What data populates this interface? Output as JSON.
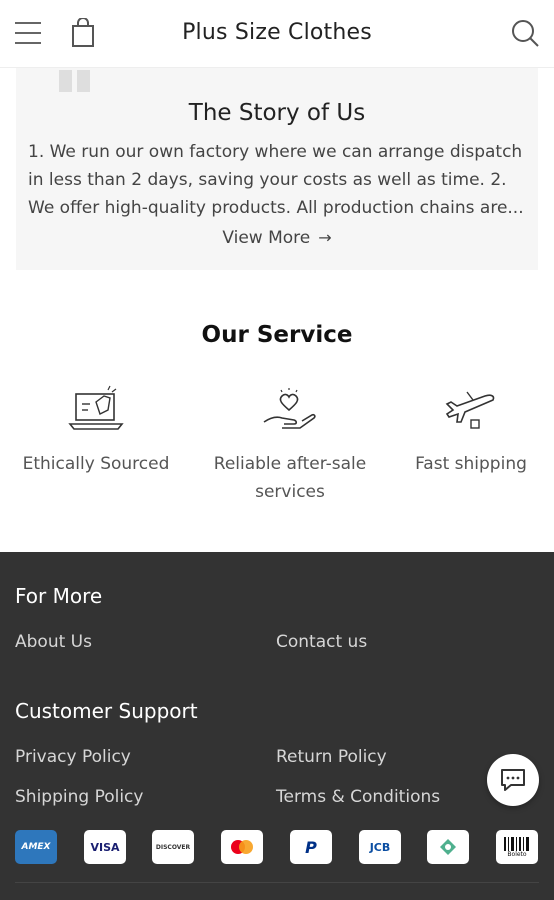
{
  "header": {
    "title": "Plus Size Clothes"
  },
  "story": {
    "title": "The Story of Us",
    "text": "1. We run our own factory where we can arrange dispatch in less than 2 days, saving your costs as well as time. 2. We offer high-quality products. All production chains are...",
    "view_more": "View More"
  },
  "service": {
    "title": "Our Service",
    "items": [
      {
        "label": "Ethically Sourced",
        "icon": "laptop-tag-icon"
      },
      {
        "label": "Reliable after-sale services",
        "icon": "heart-hand-icon"
      },
      {
        "label": "Fast shipping",
        "icon": "airplane-icon"
      }
    ]
  },
  "footer": {
    "for_more": {
      "heading": "For More",
      "links": [
        "About Us",
        "Contact us"
      ]
    },
    "support": {
      "heading": "Customer Support",
      "links": [
        "Privacy Policy",
        "Return Policy",
        "Shipping Policy",
        "Terms & Conditions"
      ]
    },
    "payments": [
      {
        "name": "amex-icon",
        "text": "AMEX",
        "color": "#2e77bc"
      },
      {
        "name": "visa-icon",
        "text": "VISA",
        "color": "#1a1f71"
      },
      {
        "name": "discover-icon",
        "text": "DISCOVER",
        "color": "#f47216"
      },
      {
        "name": "mastercard-icon",
        "text": "",
        "color": "#eb001b"
      },
      {
        "name": "paypal-icon",
        "text": "P",
        "color": "#003087"
      },
      {
        "name": "jcb-icon",
        "text": "JCB",
        "color": "#0b4ea2"
      },
      {
        "name": "afterpay-icon",
        "text": "",
        "color": "#4fb08e"
      },
      {
        "name": "boleto-icon",
        "text": "Boleto",
        "color": "#111111"
      }
    ]
  },
  "colors": {
    "footer_bg": "#333333",
    "story_bg": "#f6f6f6"
  }
}
